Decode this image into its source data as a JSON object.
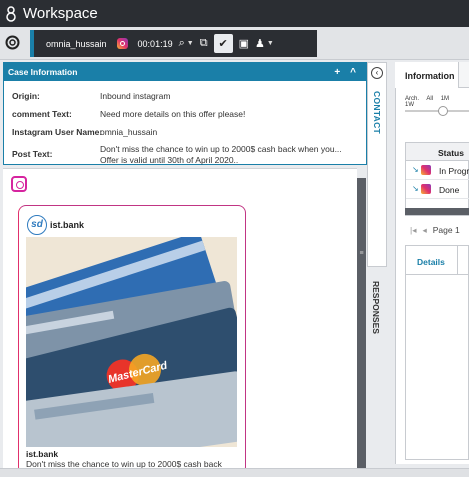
{
  "header": {
    "title": "Workspace"
  },
  "toolbar": {
    "agent_name": "omnia_hussain",
    "timer": "00:01:19"
  },
  "case_info": {
    "title": "Case Information",
    "add_label": "+",
    "collapse_label": "^",
    "fields": [
      {
        "label": "Origin:",
        "value": "Inbound instagram"
      },
      {
        "label": "comment Text:",
        "value": "Need more details on this offer please!"
      },
      {
        "label": "Instagram User Name:",
        "value": "omnia_hussain"
      },
      {
        "label": "Post Text:",
        "value": "Don't miss the chance to win up to 2000$ cash back when you... Offer is valid until 30th of April 2020.."
      }
    ]
  },
  "side_tabs": {
    "contact": "CONTACT",
    "responses": "RESPONSES"
  },
  "post": {
    "avatar_text": "sd",
    "account": "ist.bank",
    "caption_user": "ist.bank",
    "caption_text": "Don't miss the chance to win up to 2000$ cash back",
    "card_brand": "MasterCard"
  },
  "right_panel": {
    "tab": "Information",
    "timeline_labels": [
      "Arch.",
      "All",
      "1M",
      "1W"
    ],
    "table_header": "Status",
    "rows": [
      {
        "status": "In Progr"
      },
      {
        "status": "Done"
      }
    ],
    "pager": "Page 1",
    "details_tab": "Details"
  },
  "colors": {
    "accent": "#1a7fa8",
    "header_bg": "#2b2e33"
  }
}
